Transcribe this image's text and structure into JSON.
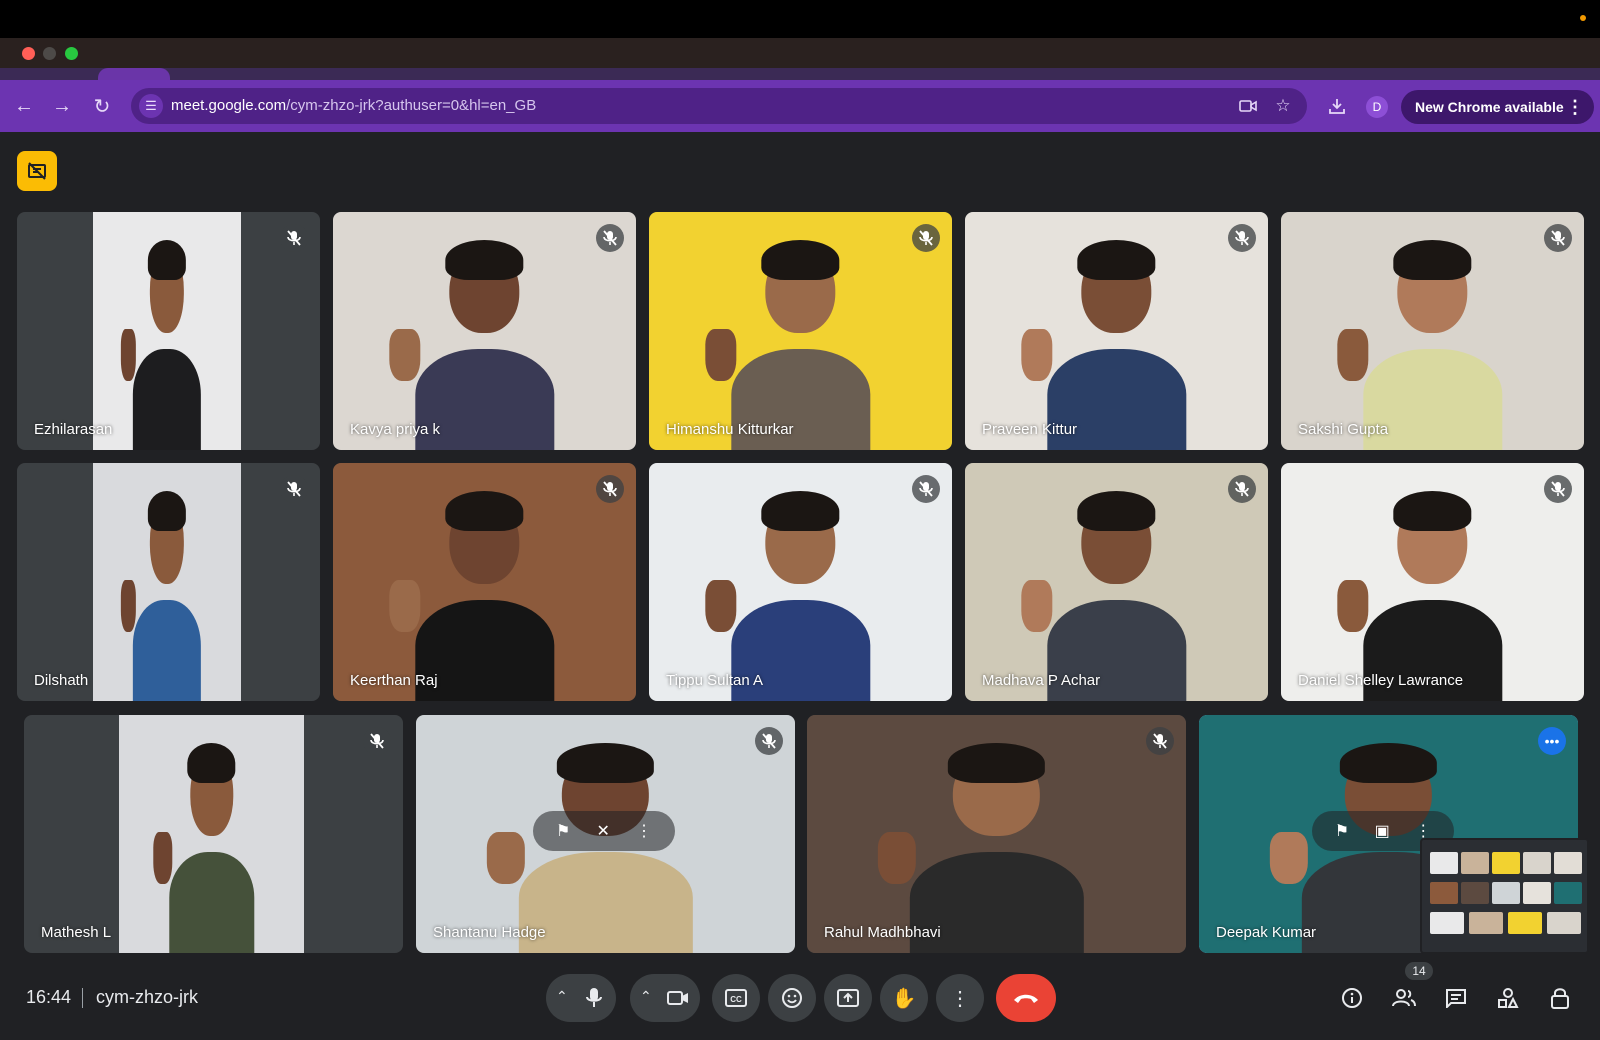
{
  "browser": {
    "url_host": "meet.google.com",
    "url_path": "/cym-zhzo-jrk?authuser=0&hl=en_GB",
    "profile_initial": "D",
    "new_chrome_label": "New Chrome available"
  },
  "tiles": [
    {
      "name": "Ezhilarasan",
      "muted": true
    },
    {
      "name": "Kavya priya k",
      "muted": true
    },
    {
      "name": "Himanshu Kitturkar",
      "muted": true
    },
    {
      "name": "Praveen Kittur",
      "muted": true
    },
    {
      "name": "Sakshi Gupta",
      "muted": true
    },
    {
      "name": "Dilshath",
      "muted": true
    },
    {
      "name": "Keerthan Raj",
      "muted": true
    },
    {
      "name": "Tippu Sultan A",
      "muted": true
    },
    {
      "name": "Madhava P Achar",
      "muted": true
    },
    {
      "name": "Daniel Shelley Lawrance",
      "muted": true
    },
    {
      "name": "Mathesh L",
      "muted": true
    },
    {
      "name": "Shantanu Hadge",
      "muted": true
    },
    {
      "name": "Rahul Madhbhavi",
      "muted": true
    },
    {
      "name": "Deepak Kumar",
      "muted": false,
      "selected": true
    }
  ],
  "meeting": {
    "time": "16:44",
    "code": "cym-zhzo-jrk",
    "participant_count": "14"
  },
  "colors": {
    "toolbar": "#6c34b1",
    "accent": "#8ab4f8",
    "end_call": "#ea4335",
    "badge": "#fbbc04"
  }
}
